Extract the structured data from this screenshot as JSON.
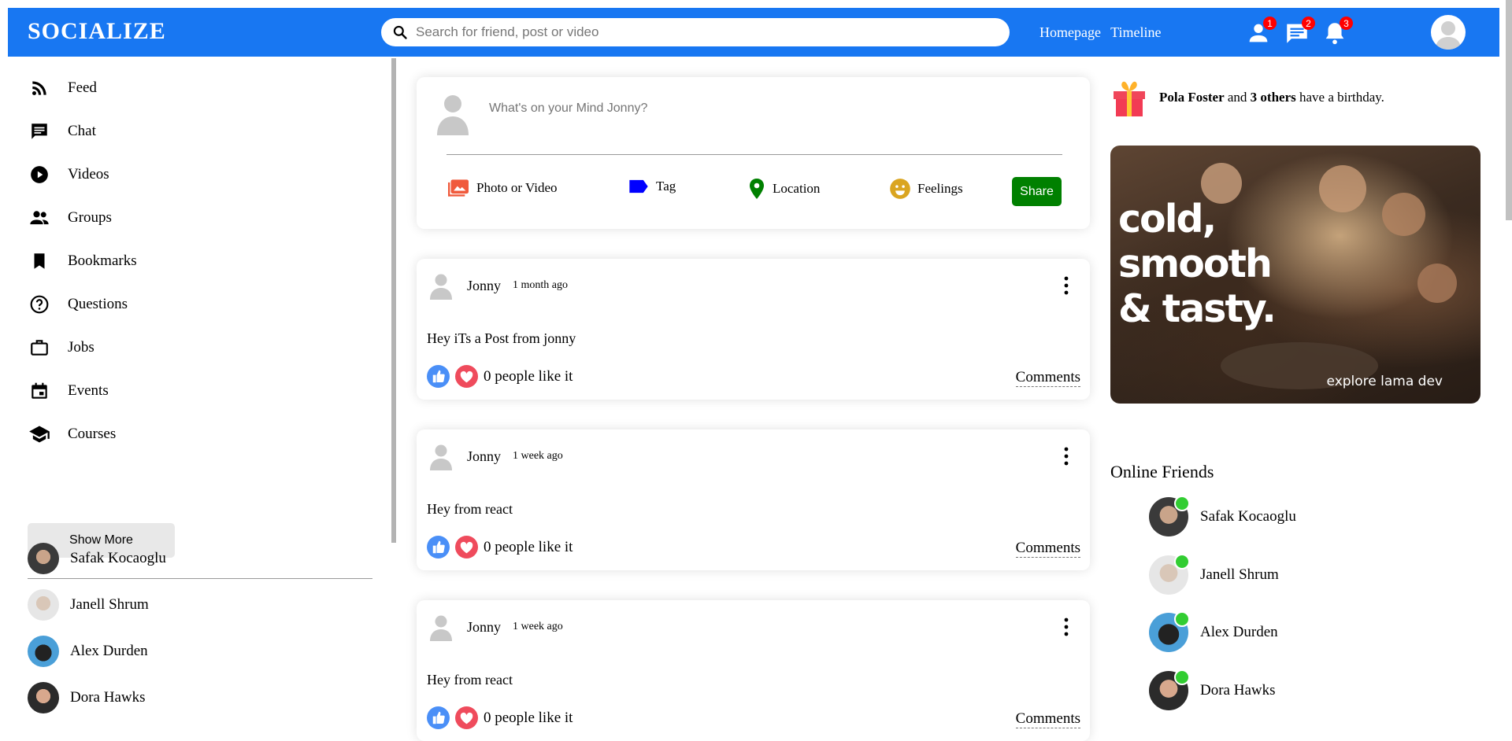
{
  "brand": {
    "logo": "SOCIALIZE",
    "accent": "#1877f2"
  },
  "search": {
    "placeholder": "Search for friend, post or video"
  },
  "nav": {
    "links": [
      "Homepage",
      "Timeline"
    ]
  },
  "notifications": {
    "friend_requests": "1",
    "messages": "2",
    "alerts": "3"
  },
  "sidebar": {
    "items": [
      {
        "label": "Feed",
        "icon": "rss-icon"
      },
      {
        "label": "Chat",
        "icon": "chat-icon"
      },
      {
        "label": "Videos",
        "icon": "play-circle-icon"
      },
      {
        "label": "Groups",
        "icon": "group-icon"
      },
      {
        "label": "Bookmarks",
        "icon": "bookmark-icon"
      },
      {
        "label": "Questions",
        "icon": "help-circle-icon"
      },
      {
        "label": "Jobs",
        "icon": "briefcase-icon"
      },
      {
        "label": "Events",
        "icon": "calendar-icon"
      },
      {
        "label": "Courses",
        "icon": "school-icon"
      }
    ],
    "show_more": "Show More",
    "friends": [
      "Safak Kocaoglu",
      "Janell Shrum",
      "Alex Durden",
      "Dora Hawks"
    ]
  },
  "share": {
    "placeholder": "What's on your Mind Jonny?",
    "options": [
      "Photo or Video",
      "Tag",
      "Location",
      "Feelings"
    ],
    "button": "Share"
  },
  "posts": [
    {
      "user": "Jonny",
      "date": "1 month ago",
      "text": "Hey iTs a Post from jonny",
      "likes": "0 people like it",
      "comments": "Comments"
    },
    {
      "user": "Jonny",
      "date": "1 week ago",
      "text": "Hey from react",
      "likes": "0 people like it",
      "comments": "Comments"
    },
    {
      "user": "Jonny",
      "date": "1 week ago",
      "text": "Hey from react",
      "likes": "0 people like it",
      "comments": "Comments"
    }
  ],
  "birthday": {
    "name": "Pola Foster",
    "middle": " and ",
    "others": "3 others",
    "suffix": " have a birthday."
  },
  "ad": {
    "line1": "cold,",
    "line2": "smooth",
    "line3": "& tasty.",
    "footer": "explore lama dev"
  },
  "online": {
    "title": "Online Friends",
    "friends": [
      "Safak Kocaoglu",
      "Janell Shrum",
      "Alex Durden",
      "Dora Hawks"
    ]
  }
}
